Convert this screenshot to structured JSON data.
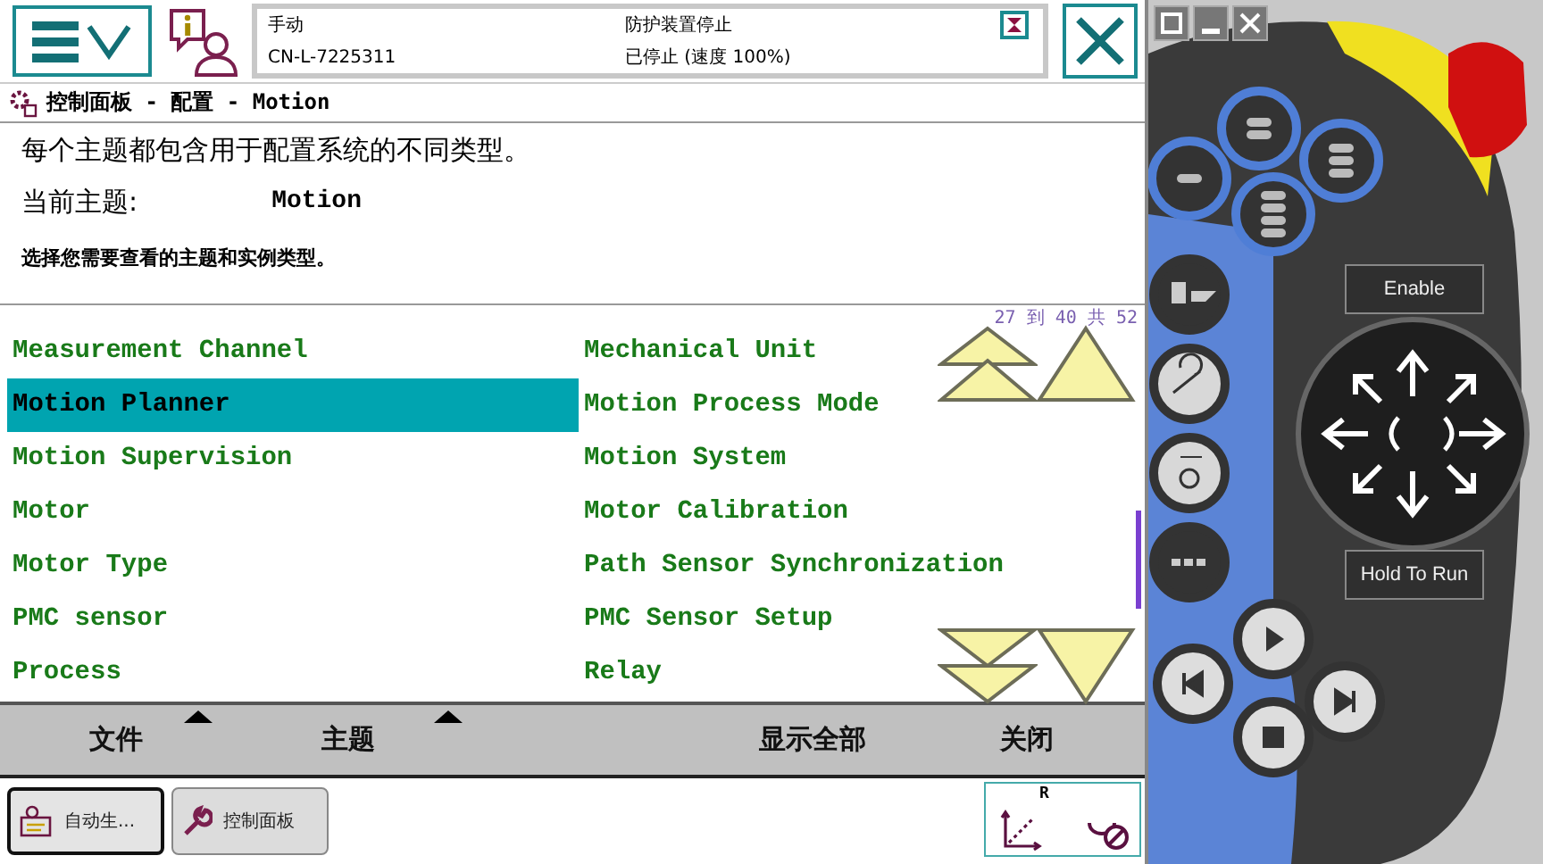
{
  "header": {
    "mode": "手动",
    "system": "CN-L-7225311",
    "safety": "防护装置停止",
    "state": "已停止 (速度 100%)"
  },
  "title": "控制面板 - 配置 - Motion",
  "description": "每个主题都包含用于配置系统的不同类型。",
  "current_topic": {
    "label": "当前主题:",
    "value": "Motion"
  },
  "instruction": "选择您需要查看的主题和实例类型。",
  "list": {
    "counter": "27 到 40 共 52",
    "items": [
      {
        "label": "Measurement Channel",
        "selected": false
      },
      {
        "label": "Mechanical Unit",
        "selected": false
      },
      {
        "label": "Motion Planner",
        "selected": true
      },
      {
        "label": "Motion Process Mode",
        "selected": false
      },
      {
        "label": "Motion Supervision",
        "selected": false
      },
      {
        "label": "Motion System",
        "selected": false
      },
      {
        "label": "Motor",
        "selected": false
      },
      {
        "label": "Motor Calibration",
        "selected": false
      },
      {
        "label": "Motor Type",
        "selected": false
      },
      {
        "label": "Path Sensor Synchronization",
        "selected": false
      },
      {
        "label": "PMC sensor",
        "selected": false
      },
      {
        "label": "PMC Sensor Setup",
        "selected": false
      },
      {
        "label": "Process",
        "selected": false
      },
      {
        "label": "Relay",
        "selected": false
      }
    ]
  },
  "menu": [
    {
      "label": "文件",
      "has_menu": true
    },
    {
      "label": "主题",
      "has_menu": true
    },
    {
      "label": "显示全部",
      "has_menu": false
    },
    {
      "label": "关闭",
      "has_menu": false
    }
  ],
  "taskbar": [
    {
      "label": "自动生...",
      "selected": true,
      "kind": "program"
    },
    {
      "label": "控制面板",
      "selected": false,
      "kind": "control-panel"
    }
  ],
  "quickset": {
    "label": "R"
  },
  "pendant": {
    "buttons": [
      "Enable",
      "Hold To Run"
    ]
  }
}
